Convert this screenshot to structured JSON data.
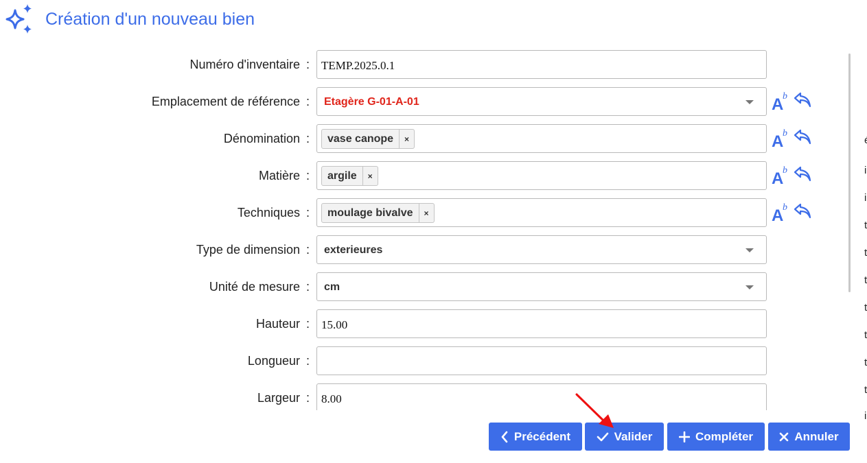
{
  "dialog": {
    "title": "Création d'un nouveau bien",
    "title_icon": "sparkles-icon"
  },
  "colors": {
    "accent": "#3d6de8",
    "error_red": "#e0251b",
    "annotation_arrow": "#ee1111"
  },
  "form": {
    "rows": [
      {
        "label": "Numéro d'inventaire",
        "colon": ":",
        "type": "text",
        "value": "TEMP.2025.0.1"
      },
      {
        "label": "Emplacement de référence",
        "colon": ":",
        "type": "select",
        "value": "Etagère G-01-A-01"
      },
      {
        "label": "Dénomination",
        "colon": ":",
        "type": "tags",
        "value": "vase canope",
        "remove": "×"
      },
      {
        "label": "Matière",
        "colon": ":",
        "type": "tags",
        "value": "argile",
        "remove": "×"
      },
      {
        "label": "Techniques",
        "colon": ":",
        "type": "tags",
        "value": "moulage bivalve",
        "remove": "×"
      },
      {
        "label": "Type de dimension",
        "colon": ":",
        "type": "select",
        "value": "exterieures"
      },
      {
        "label": "Unité de mesure",
        "colon": ":",
        "type": "select",
        "value": "cm"
      },
      {
        "label": "Hauteur",
        "colon": ":",
        "type": "text",
        "value": "15.00"
      },
      {
        "label": "Longueur",
        "colon": ":",
        "type": "text",
        "value": ""
      },
      {
        "label": "Largeur",
        "colon": ":",
        "type": "text",
        "value": "8.00"
      }
    ],
    "tool_icons": {
      "format": "A",
      "format_sup": "b",
      "format_name": "text-format-icon",
      "reset_name": "undo-arrow-icon"
    }
  },
  "buttons": {
    "previous": "Précédent",
    "validate": "Valider",
    "complete": "Compléter",
    "cancel": "Annuler"
  },
  "right_strip": {
    "chars": [
      "é",
      "i",
      "i",
      "t",
      "t",
      "t",
      "t",
      "t",
      "t",
      "t",
      "i"
    ]
  }
}
